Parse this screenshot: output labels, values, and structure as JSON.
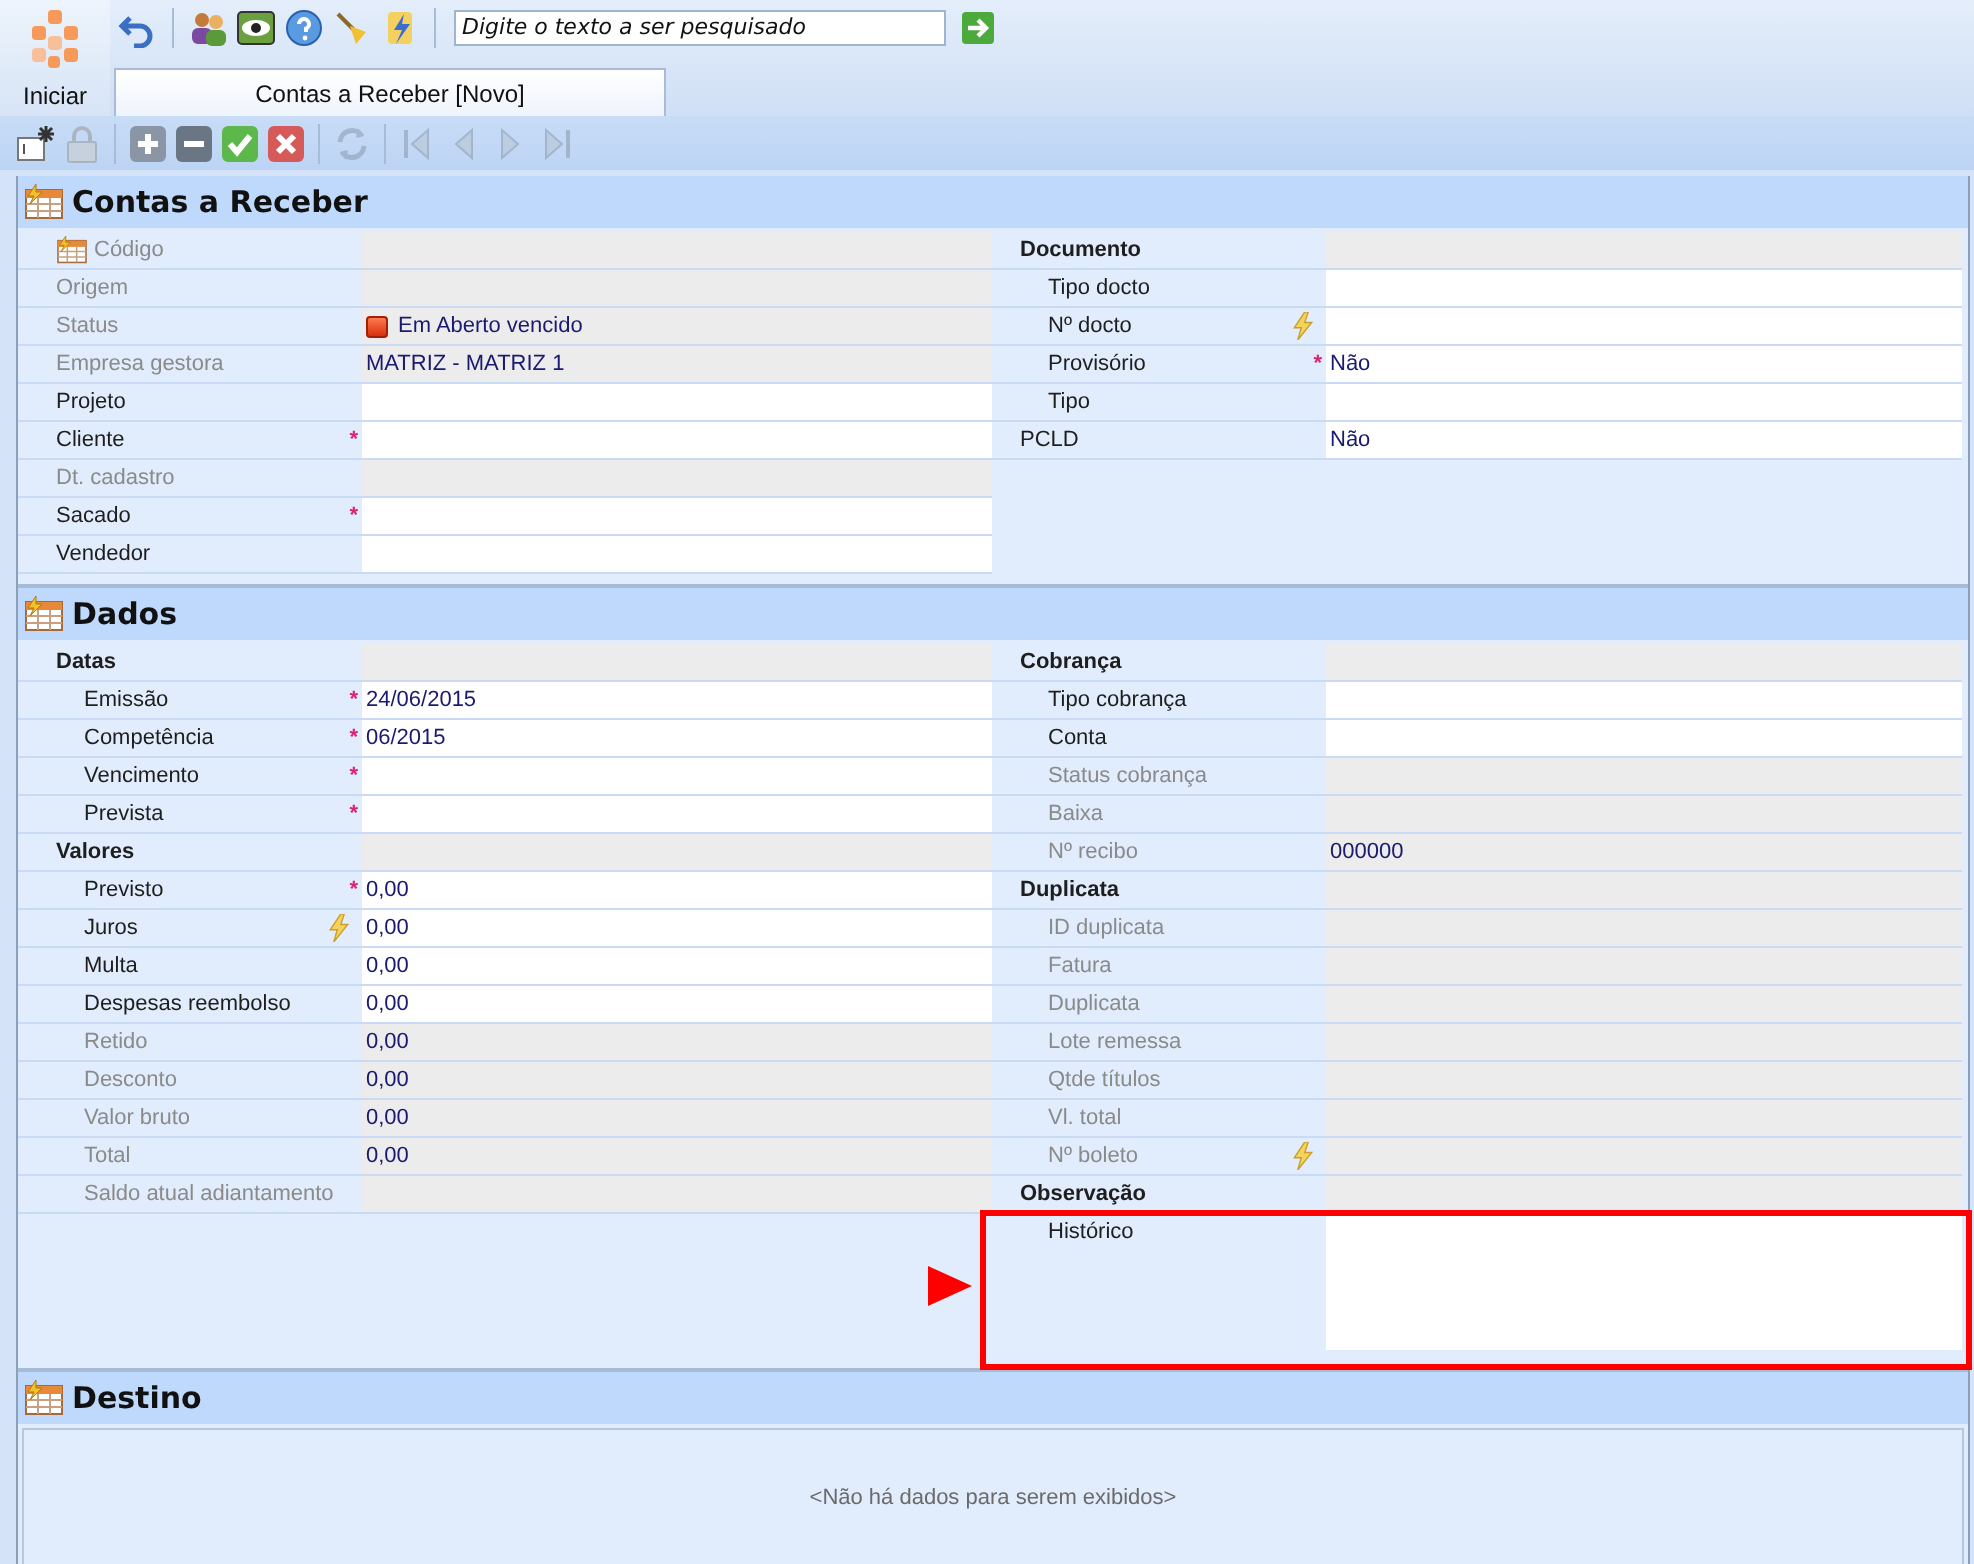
{
  "app_button": {
    "label": "Iniciar"
  },
  "top_toolbar": [
    {
      "kind": "undo",
      "disabled": false
    },
    {
      "kind": "users",
      "disabled": false
    },
    {
      "kind": "eye",
      "disabled": false
    },
    {
      "kind": "help",
      "disabled": false
    },
    {
      "kind": "broom",
      "disabled": false
    },
    {
      "kind": "bolt-doc",
      "disabled": false
    }
  ],
  "search": {
    "placeholder": "Digite o texto a ser pesquisado"
  },
  "tabs": [
    {
      "label": "Contas a Receber [Novo]",
      "selected": true
    }
  ],
  "record_toolbar": [
    {
      "kind": "new",
      "disabled": false
    },
    {
      "kind": "lock",
      "disabled": true
    },
    {
      "kind": "plus",
      "disabled": false
    },
    {
      "kind": "minus",
      "disabled": false
    },
    {
      "kind": "check",
      "disabled": false
    },
    {
      "kind": "cancel",
      "disabled": false
    },
    {
      "kind": "refresh",
      "disabled": true
    },
    {
      "kind": "first",
      "disabled": true
    },
    {
      "kind": "prev",
      "disabled": true
    },
    {
      "kind": "next",
      "disabled": true
    },
    {
      "kind": "last",
      "disabled": true
    }
  ],
  "sections": [
    {
      "title": "Contas a Receber",
      "columns": [
        [
          {
            "kind": "field",
            "label": "Código",
            "disabled": true,
            "code_icon": true
          },
          {
            "kind": "field",
            "label": "Origem",
            "disabled": true
          },
          {
            "kind": "field",
            "label": "Status",
            "disabled": true,
            "value": "Em Aberto vencido",
            "status_icon": true
          },
          {
            "kind": "field",
            "label": "Empresa gestora",
            "disabled": true,
            "value": "MATRIZ - MATRIZ 1"
          },
          {
            "kind": "field",
            "label": "Projeto",
            "disabled": false
          },
          {
            "kind": "field",
            "label": "Cliente",
            "disabled": false,
            "required": "*"
          },
          {
            "kind": "field",
            "label": "Dt. cadastro",
            "disabled": true
          },
          {
            "kind": "field",
            "label": "Sacado",
            "disabled": false,
            "required": "*"
          },
          {
            "kind": "field",
            "label": "Vendedor",
            "disabled": false
          }
        ],
        [
          {
            "kind": "group",
            "label": "Documento",
            "children": [
              {
                "kind": "field",
                "label": "Tipo docto",
                "disabled": false
              },
              {
                "kind": "field",
                "label": "Nº docto",
                "disabled": false,
                "auto": true
              },
              {
                "kind": "field",
                "label": "Provisório",
                "disabled": false,
                "required": "*",
                "value": "Não"
              },
              {
                "kind": "field",
                "label": "Tipo",
                "disabled": false
              }
            ]
          },
          {
            "kind": "field",
            "label": "PCLD",
            "disabled": false,
            "value": "Não"
          }
        ]
      ]
    },
    {
      "title": "Dados",
      "columns": [
        [
          {
            "kind": "group",
            "label": "Datas",
            "children": [
              {
                "kind": "field",
                "label": "Emissão",
                "disabled": false,
                "required": "*",
                "value": "24/06/2015"
              },
              {
                "kind": "field",
                "label": "Competência",
                "disabled": false,
                "required": "*",
                "value": "06/2015"
              },
              {
                "kind": "field",
                "label": "Vencimento",
                "disabled": false,
                "required": "*"
              },
              {
                "kind": "field",
                "label": "Prevista",
                "disabled": false,
                "required": "*"
              }
            ]
          },
          {
            "kind": "group",
            "label": "Valores",
            "children": [
              {
                "kind": "field",
                "label": "Previsto",
                "disabled": false,
                "required": "*",
                "value": "0,00"
              },
              {
                "kind": "field",
                "label": "Juros",
                "disabled": false,
                "auto": true,
                "value": "0,00"
              },
              {
                "kind": "field",
                "label": "Multa",
                "disabled": false,
                "value": "0,00"
              },
              {
                "kind": "field",
                "label": "Despesas reembolso",
                "disabled": false,
                "value": "0,00"
              },
              {
                "kind": "field",
                "label": "Retido",
                "disabled": true,
                "value": "0,00"
              },
              {
                "kind": "field",
                "label": "Desconto",
                "disabled": true,
                "value": "0,00"
              },
              {
                "kind": "field",
                "label": "Valor bruto",
                "disabled": true,
                "value": "0,00"
              },
              {
                "kind": "field",
                "label": "Total",
                "disabled": true,
                "value": "0,00"
              },
              {
                "kind": "field",
                "label": "Saldo atual adiantamento",
                "disabled": true
              }
            ]
          }
        ],
        [
          {
            "kind": "group",
            "label": "Cobrança",
            "children": [
              {
                "kind": "field",
                "label": "Tipo cobrança",
                "disabled": false
              },
              {
                "kind": "field",
                "label": "Conta",
                "disabled": false
              },
              {
                "kind": "field",
                "label": "Status cobrança",
                "disabled": true
              },
              {
                "kind": "field",
                "label": "Baixa",
                "disabled": true
              },
              {
                "kind": "field",
                "label": "Nº recibo",
                "disabled": true,
                "value": "000000"
              }
            ]
          },
          {
            "kind": "group",
            "label": "Duplicata",
            "children": [
              {
                "kind": "field",
                "label": "ID duplicata",
                "disabled": true
              },
              {
                "kind": "field",
                "label": "Fatura",
                "disabled": true
              },
              {
                "kind": "field",
                "label": "Duplicata",
                "disabled": true
              },
              {
                "kind": "field",
                "label": "Lote remessa",
                "disabled": true
              },
              {
                "kind": "field",
                "label": "Qtde títulos",
                "disabled": true
              },
              {
                "kind": "field",
                "label": "Vl. total",
                "disabled": true
              },
              {
                "kind": "field",
                "label": "Nº boleto",
                "disabled": true,
                "auto": true
              }
            ]
          },
          {
            "kind": "group",
            "label": "Observação",
            "children": [
              {
                "kind": "memo",
                "label": "Histórico",
                "disabled": false,
                "highlighted": true
              }
            ]
          }
        ]
      ]
    },
    {
      "title": "Destino",
      "empty_message": "<Não há dados para serem exibidos>"
    }
  ]
}
